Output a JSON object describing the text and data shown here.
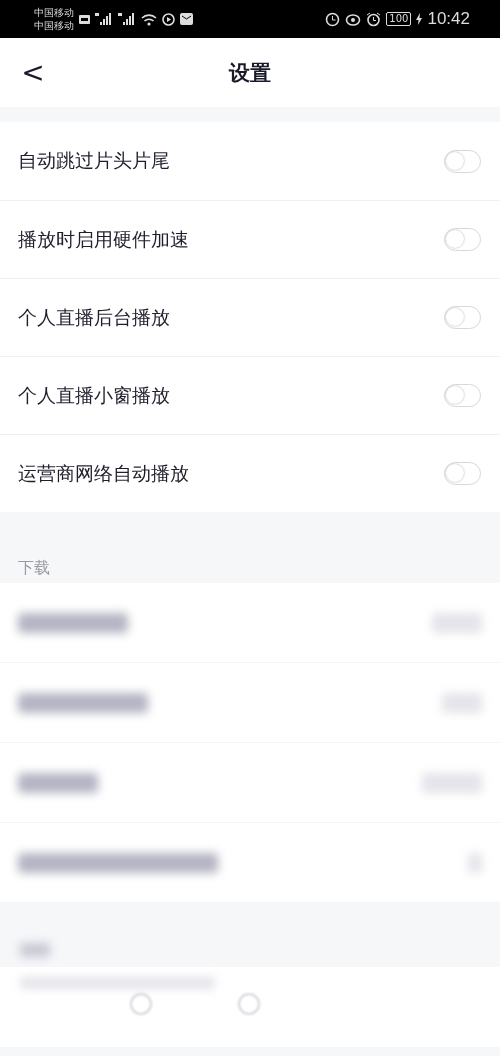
{
  "status_bar": {
    "carriers": [
      "中国移动",
      "中国移动"
    ],
    "battery": "100",
    "time": "10:42"
  },
  "nav": {
    "back": "<",
    "title": "设置"
  },
  "toggles": [
    {
      "label": "自动跳过片头片尾",
      "on": false
    },
    {
      "label": "播放时启用硬件加速",
      "on": false
    },
    {
      "label": "个人直播后台播放",
      "on": false
    },
    {
      "label": "个人直播小窗播放",
      "on": false
    },
    {
      "label": "运营商网络自动播放",
      "on": false
    }
  ],
  "download_section": {
    "title": "下载"
  }
}
